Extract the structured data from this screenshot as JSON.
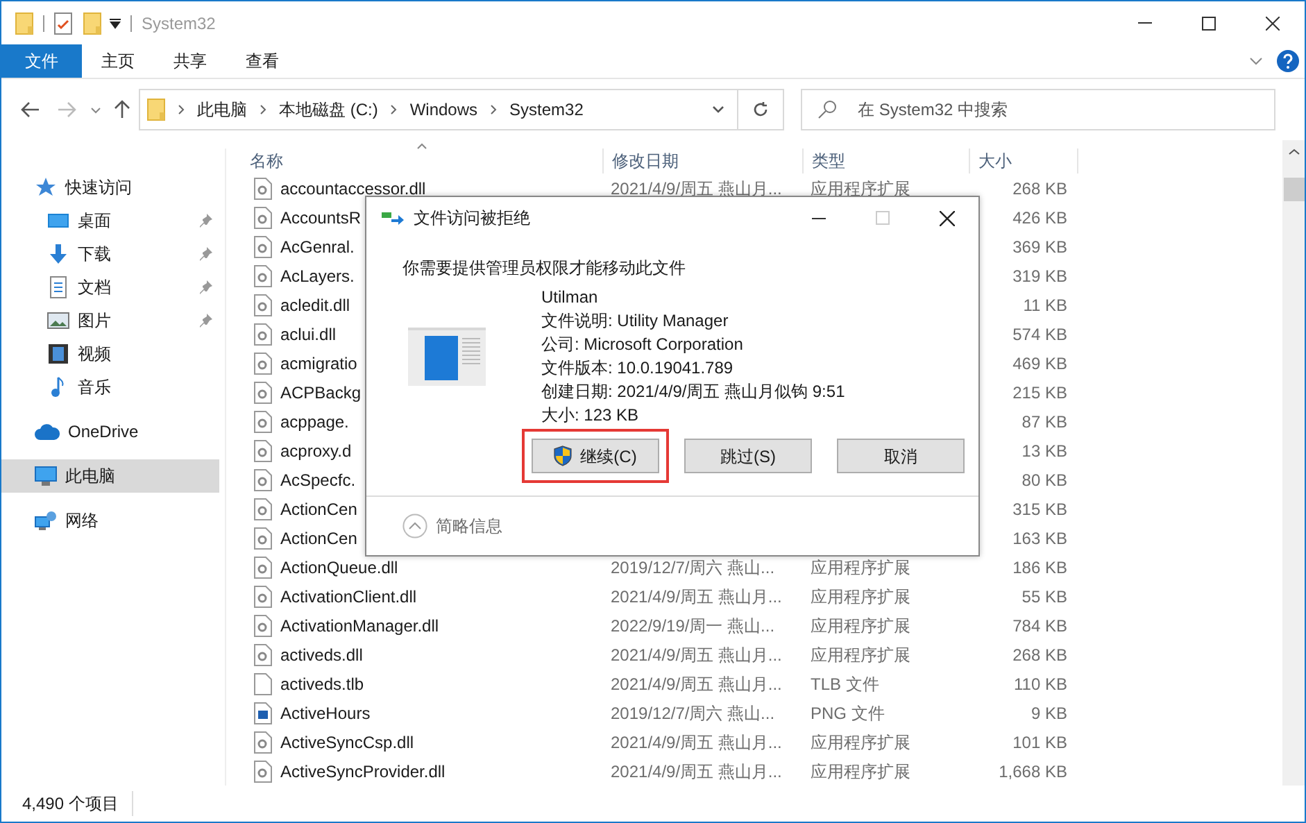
{
  "title_bar": {
    "title": "System32"
  },
  "ribbon_tabs": [
    {
      "label": "文件",
      "selected": true
    },
    {
      "label": "主页",
      "selected": false
    },
    {
      "label": "共享",
      "selected": false
    },
    {
      "label": "查看",
      "selected": false
    }
  ],
  "address_bar": {
    "crumbs": [
      "此电脑",
      "本地磁盘 (C:)",
      "Windows",
      "System32"
    ]
  },
  "search": {
    "placeholder": "在 System32 中搜索"
  },
  "sidebar": {
    "items": [
      {
        "label": "快速访问",
        "kind": "star",
        "pinned": false,
        "selected": false
      },
      {
        "label": "桌面",
        "kind": "desktop",
        "pinned": true,
        "selected": false
      },
      {
        "label": "下载",
        "kind": "download",
        "pinned": true,
        "selected": false
      },
      {
        "label": "文档",
        "kind": "document",
        "pinned": true,
        "selected": false
      },
      {
        "label": "图片",
        "kind": "image",
        "pinned": true,
        "selected": false
      },
      {
        "label": "视频",
        "kind": "video",
        "pinned": false,
        "selected": false
      },
      {
        "label": "音乐",
        "kind": "music",
        "pinned": false,
        "selected": false
      },
      {
        "label": "OneDrive",
        "kind": "cloud",
        "pinned": false,
        "selected": false
      },
      {
        "label": "此电脑",
        "kind": "computer",
        "pinned": false,
        "selected": true
      },
      {
        "label": "网络",
        "kind": "network",
        "pinned": false,
        "selected": false
      }
    ]
  },
  "table": {
    "columns": [
      "名称",
      "修改日期",
      "类型",
      "大小"
    ],
    "rows": [
      {
        "kind": "dll",
        "name": "accountaccessor.dll",
        "date": "2021/4/9/周五 燕山月...",
        "type": "应用程序扩展",
        "size": "268 KB"
      },
      {
        "kind": "dll",
        "name": "AccountsR",
        "size": "426 KB"
      },
      {
        "kind": "dll",
        "name": "AcGenral.",
        "size": "369 KB"
      },
      {
        "kind": "dll",
        "name": "AcLayers.",
        "size": "319 KB"
      },
      {
        "kind": "dll",
        "name": "acledit.dll",
        "size": "11 KB"
      },
      {
        "kind": "dll",
        "name": "aclui.dll",
        "size": "574 KB"
      },
      {
        "kind": "dll",
        "name": "acmigratio",
        "size": "469 KB"
      },
      {
        "kind": "dll",
        "name": "ACPBackg",
        "size": "215 KB"
      },
      {
        "kind": "dll",
        "name": "acppage.",
        "size": "87 KB"
      },
      {
        "kind": "dll",
        "name": "acproxy.d",
        "size": "13 KB"
      },
      {
        "kind": "dll",
        "name": "AcSpecfc.",
        "size": "80 KB"
      },
      {
        "kind": "dll",
        "name": "ActionCen",
        "size": "315 KB"
      },
      {
        "kind": "dll",
        "name": "ActionCen",
        "size": "163 KB"
      },
      {
        "kind": "dll",
        "name": "ActionQueue.dll",
        "date": "2019/12/7/周六 燕山...",
        "type": "应用程序扩展",
        "size": "186 KB"
      },
      {
        "kind": "dll",
        "name": "ActivationClient.dll",
        "date": "2021/4/9/周五 燕山月...",
        "type": "应用程序扩展",
        "size": "55 KB"
      },
      {
        "kind": "dll",
        "name": "ActivationManager.dll",
        "date": "2022/9/19/周一 燕山...",
        "type": "应用程序扩展",
        "size": "784 KB"
      },
      {
        "kind": "dll",
        "name": "activeds.dll",
        "date": "2021/4/9/周五 燕山月...",
        "type": "应用程序扩展",
        "size": "268 KB"
      },
      {
        "kind": "blank",
        "name": "activeds.tlb",
        "date": "2021/4/9/周五 燕山月...",
        "type": "TLB 文件",
        "size": "110 KB"
      },
      {
        "kind": "image",
        "name": "ActiveHours",
        "date": "2019/12/7/周六 燕山...",
        "type": "PNG 文件",
        "size": "9 KB"
      },
      {
        "kind": "dll",
        "name": "ActiveSyncCsp.dll",
        "date": "2021/4/9/周五 燕山月...",
        "type": "应用程序扩展",
        "size": "101 KB"
      },
      {
        "kind": "dll",
        "name": "ActiveSyncProvider.dll",
        "date": "2021/4/9/周五 燕山月...",
        "type": "应用程序扩展",
        "size": "1,668 KB"
      }
    ]
  },
  "status_bar": {
    "item_count": "4,490 个项目"
  },
  "dialog": {
    "title": "文件访问被拒绝",
    "message": "你需要提供管理员权限才能移动此文件",
    "file_name": "Utilman",
    "details": [
      "文件说明: Utility Manager",
      "公司: Microsoft Corporation",
      "文件版本: 10.0.19041.789",
      "创建日期: 2021/4/9/周五 燕山月似钩 9:51",
      "大小: 123 KB"
    ],
    "buttons": [
      {
        "label": "继续(C)",
        "shield": true,
        "highlighted": true
      },
      {
        "label": "跳过(S)",
        "shield": false,
        "highlighted": false
      },
      {
        "label": "取消",
        "shield": false,
        "highlighted": false
      }
    ],
    "footer": "简略信息"
  }
}
